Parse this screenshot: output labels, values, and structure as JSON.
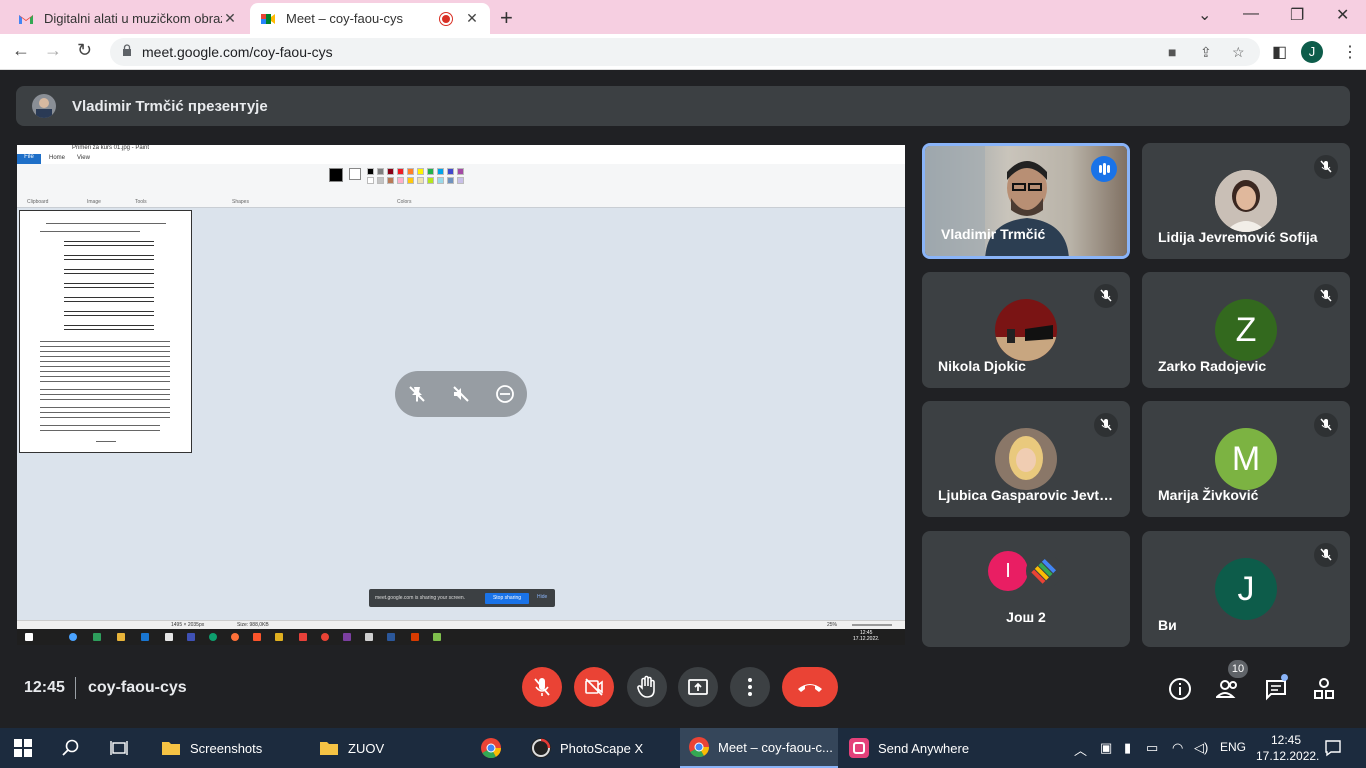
{
  "browser": {
    "tabs": [
      {
        "title": "Digitalni alati u muzičkom obrazo",
        "icon": "gmail-icon"
      },
      {
        "title": "Meet – coy-faou-cys",
        "icon": "meet-icon",
        "recording": true
      }
    ],
    "url": "meet.google.com/coy-faou-cys",
    "profile_initial": "J"
  },
  "meet": {
    "presenter_text": "Vladimir Trmčić презентује",
    "time": "12:45",
    "code": "coy-faou-cys",
    "people_count": "10",
    "tiles": [
      {
        "name": "Vladimir Trmčić",
        "type": "video",
        "speaking": true
      },
      {
        "name": "Lidija Jevremović Sofija",
        "type": "photo",
        "muted": true
      },
      {
        "name": "Nikola Djokic",
        "type": "photo",
        "muted": true
      },
      {
        "name": "Zarko Radojevic",
        "type": "letter",
        "letter": "Z",
        "color": "#33691e",
        "muted": true
      },
      {
        "name": "Ljubica Gasparovic Jevt…",
        "type": "photo",
        "muted": true
      },
      {
        "name": "Marija Živković",
        "type": "letter",
        "letter": "M",
        "color": "#7cb342",
        "muted": true
      },
      {
        "name": "Још 2",
        "type": "more",
        "letter": "I",
        "color": "#e91e63"
      },
      {
        "name": "Ви",
        "type": "letter",
        "letter": "J",
        "color": "#0d5c4a",
        "muted": true
      }
    ]
  },
  "shared_screen": {
    "paint_title": "Primeri za kurs 01.jpg - Paint",
    "menu": [
      "File",
      "Home",
      "View"
    ],
    "groups": [
      "Clipboard",
      "Image",
      "Tools",
      "Shapes",
      "Colors"
    ],
    "status_size": "1495 × 2035px",
    "status_file": "Size: 988,0KB",
    "zoom": "25%",
    "notice_text": "meet.google.com is sharing your screen.",
    "stop_label": "Stop sharing",
    "hide_label": "Hide",
    "taskbar_time": "12:45",
    "taskbar_date": "17.12.2022."
  },
  "taskbar": {
    "items": [
      {
        "label": "Screenshots",
        "icon": "folder-icon"
      },
      {
        "label": "ZUOV",
        "icon": "folder-icon"
      },
      {
        "label": "",
        "icon": "chrome-icon"
      },
      {
        "label": "PhotoScape X",
        "icon": "photoscape-icon"
      },
      {
        "label": "Meet – coy-faou-c...",
        "icon": "chrome-icon",
        "active": true
      },
      {
        "label": "Send Anywhere",
        "icon": "send-anywhere-icon"
      }
    ],
    "lang": "ENG",
    "time": "12:45",
    "date": "17.12.2022."
  },
  "colors": {
    "accent": "#1a73e8",
    "danger": "#ea4335",
    "meet_bg": "#202124",
    "tile_bg": "#3c4043"
  }
}
